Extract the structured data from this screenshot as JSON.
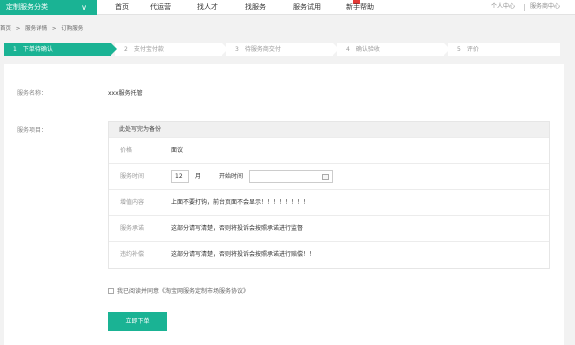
{
  "topbar": {
    "category_button": "定制服务分类",
    "nav": [
      "首页",
      "代运营",
      "找人才",
      "找服务",
      "服务试用",
      "新手帮助"
    ],
    "user_center": "个人中心",
    "provider_center": "服务商中心"
  },
  "breadcrumb": [
    "首页",
    ">",
    "服务详情",
    ">",
    "订购服务"
  ],
  "steps": [
    {
      "num": "1",
      "label": "下单待确认"
    },
    {
      "num": "2",
      "label": "支付宝付款"
    },
    {
      "num": "3",
      "label": "待服务商交付"
    },
    {
      "num": "4",
      "label": "确认验收"
    },
    {
      "num": "5",
      "label": "评价"
    }
  ],
  "form": {
    "service_name_label": "服务名称：",
    "service_name_value": "xxx服务托管",
    "service_item_label": "服务项目：",
    "table_title": "此处写完为备份",
    "price_label": "价格",
    "price_value": "面议",
    "duration_label": "服务时间",
    "month_value": "12",
    "month_unit": "月",
    "start_label": "开始时间",
    "extra_label": "增值内容",
    "extra_value": "上面不要打钩，前台页面不会显示！！！！！！！！",
    "promise_label": "服务承诺",
    "promise_value": "这部分请写清楚，否则将投诉会按照承诺进行监督",
    "penalty_label": "违约补偿",
    "penalty_value": "这部分请写清楚，否则将投诉会按照承诺进行赔偿！！",
    "agree_text": "我已阅读并同意《淘宝网服务定制市场服务协议》",
    "submit_label": "立即下单"
  },
  "colors": {
    "accent": "#1ab394"
  }
}
